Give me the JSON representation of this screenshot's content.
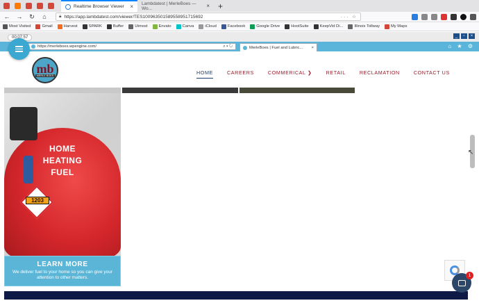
{
  "browser": {
    "pinned_tab_colors": [
      "#d44638",
      "#ff7a00",
      "#d44638",
      "#d44638",
      "#d44638"
    ],
    "tabs": [
      {
        "title": "Realtime Browser Viewer",
        "active": true
      },
      {
        "title": "Lambdatest | MerleBoes — Wo...",
        "active": false
      }
    ],
    "new_tab_glyph": "+",
    "url": "https://app.lambdatest.com/viewer/TES100963501589558951715692",
    "url_suffix_glyphs": "··· ☆",
    "bookmarks": [
      {
        "label": "Most Visited",
        "color": "#555"
      },
      {
        "label": "Gmail",
        "color": "#d44638"
      },
      {
        "label": "Harvest",
        "color": "#f36c21"
      },
      {
        "label": "SPARK",
        "color": "#333"
      },
      {
        "label": "Buffer",
        "color": "#333"
      },
      {
        "label": "Utmost",
        "color": "#666"
      },
      {
        "label": "Envato",
        "color": "#82b541"
      },
      {
        "label": "Canva",
        "color": "#00c4cc"
      },
      {
        "label": "iCloud",
        "color": "#999"
      },
      {
        "label": "Facebook",
        "color": "#3b5998"
      },
      {
        "label": "Google Drive",
        "color": "#0f9d58"
      },
      {
        "label": "HootSuite",
        "color": "#333"
      },
      {
        "label": "KeepVid Di...",
        "color": "#333"
      },
      {
        "label": "Illinois Tollway",
        "color": "#666"
      },
      {
        "label": "My Maps",
        "color": "#d44638"
      }
    ]
  },
  "viewer": {
    "timer": "00:07:57",
    "window_controls": [
      "_",
      "▫",
      "×"
    ],
    "inner_url": "https://merleboes.wpengine.com/",
    "inner_tab_title": "MerleBoes | Fuel and Lubric...",
    "nav_icons": "⌂ ★ ⚙"
  },
  "site": {
    "logo_text": "mb",
    "logo_subtext": "MERLE BOES",
    "menu": [
      {
        "label": "HOME",
        "active": true
      },
      {
        "label": "CAREERS",
        "active": false
      },
      {
        "label": "COMMERICAL ❯",
        "active": false
      },
      {
        "label": "RETAIL",
        "active": false
      },
      {
        "label": "RECLAMATION",
        "active": false
      },
      {
        "label": "CONTACT US",
        "active": false
      }
    ],
    "card": {
      "title_line1": "HOME",
      "title_line2": "HEATING",
      "title_line3": "FUEL",
      "hazard_number": "1203",
      "learn_more": "LEARN MORE",
      "description": "We deliver fuel to your home so you can give your attention to other matters."
    },
    "chat_badge": "1"
  },
  "colors": {
    "brand_maroon": "#9a1a2a",
    "brand_blue": "#5ab5d7",
    "nav_active": "#1d3d6b",
    "footer": "#0e1a45"
  }
}
